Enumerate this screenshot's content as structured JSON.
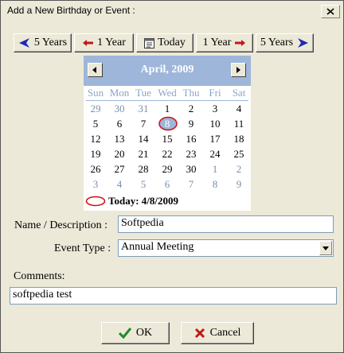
{
  "window": {
    "title": "Add a New Birthday or Event :"
  },
  "nav": {
    "back5": "5 Years",
    "back1": "1 Year",
    "today": "Today",
    "fwd1": "1 Year",
    "fwd5": "5 Years"
  },
  "calendar": {
    "month": "April, 2009",
    "weekdays": [
      "Sun",
      "Mon",
      "Tue",
      "Wed",
      "Thu",
      "Fri",
      "Sat"
    ],
    "weeks": [
      [
        "29",
        "30",
        "31",
        "1",
        "2",
        "3",
        "4"
      ],
      [
        "5",
        "6",
        "7",
        "8",
        "9",
        "10",
        "11"
      ],
      [
        "12",
        "13",
        "14",
        "15",
        "16",
        "17",
        "18"
      ],
      [
        "19",
        "20",
        "21",
        "22",
        "23",
        "24",
        "25"
      ],
      [
        "26",
        "27",
        "28",
        "29",
        "30",
        "1",
        "2"
      ],
      [
        "3",
        "4",
        "5",
        "6",
        "7",
        "8",
        "9"
      ]
    ],
    "today_text": "Today: 4/8/2009"
  },
  "form": {
    "name_label": "Name / Description :",
    "name_value": "Softpedia",
    "type_label": "Event Type :",
    "type_value": "Annual Meeting",
    "comments_label": "Comments:",
    "comments_value": "softpedia test"
  },
  "buttons": {
    "ok": "OK",
    "cancel": "Cancel"
  },
  "colors": {
    "calendar_header": "#9eb6d9",
    "weekday_text": "#8aa4c8",
    "other_month_text": "#7a8fae",
    "today_circle": "#d01010",
    "nav_arrow_blue": "#1f2bb3",
    "nav_arrow_red": "#c01818"
  }
}
